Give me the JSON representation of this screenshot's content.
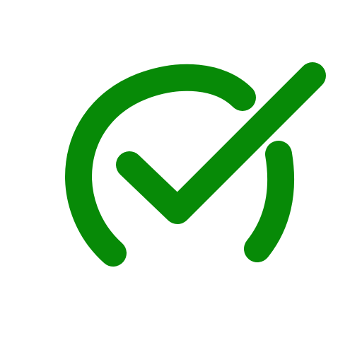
{
  "icon": {
    "name": "check-gauge-icon",
    "color": "#078a07",
    "background": "#ffffff"
  }
}
